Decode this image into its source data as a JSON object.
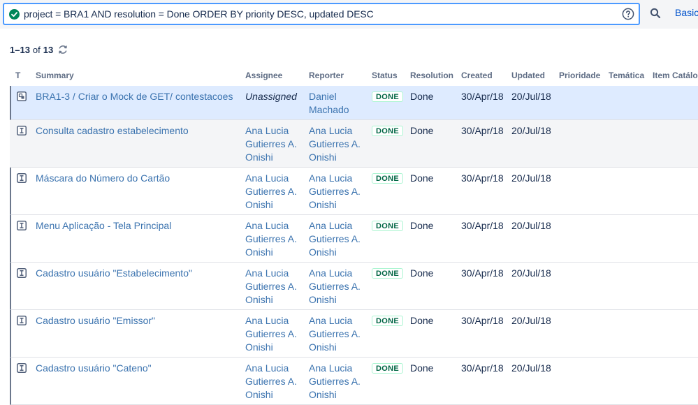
{
  "search": {
    "jql_parts": {
      "p1": "project = ",
      "p2": "BRA1",
      "p3": " ",
      "p4": "AND",
      "p5": " ",
      "p6": "resolution",
      "p7": " = ",
      "p8": "Done",
      "p9": " ORDER ",
      "p10": "BY",
      "p11": " priority DESC, ",
      "p12": "updated",
      "p13": " ",
      "p14": "DESC"
    },
    "valid_icon": "check-circle-icon",
    "help_icon": "question-circle-icon",
    "search_icon": "magnifier-icon",
    "basic_label": "Basic"
  },
  "results": {
    "range": "1–13",
    "of_label": "of",
    "total": "13",
    "refresh_icon": "refresh-icon"
  },
  "columns": {
    "type": "T",
    "summary": "Summary",
    "assignee": "Assignee",
    "reporter": "Reporter",
    "status": "Status",
    "resolution": "Resolution",
    "created": "Created",
    "updated": "Updated",
    "priority": "Prioridade",
    "tematica": "Temática",
    "item": "Item Catálog"
  },
  "rows": [
    {
      "type_icon": "subtask-icon",
      "summary_parent": "BRA1-3",
      "summary_sep": " / ",
      "summary": "Criar o Mock de GET/ contestacoes",
      "assignee": [
        "Unassigned"
      ],
      "reporter": [
        "Daniel",
        "Machado"
      ],
      "status": "DONE",
      "resolution": "Done",
      "created": "30/Apr/18",
      "updated": "20/Jul/18"
    },
    {
      "type_icon": "story-icon",
      "summary": "Consulta cadastro estabelecimento",
      "assignee": [
        "Ana Lucia",
        "Gutierres A.",
        "Onishi"
      ],
      "reporter": [
        "Ana Lucia",
        "Gutierres A.",
        "Onishi"
      ],
      "status": "DONE",
      "resolution": "Done",
      "created": "30/Apr/18",
      "updated": "20/Jul/18"
    },
    {
      "type_icon": "story-icon",
      "summary": "Máscara do Número do Cartão",
      "assignee": [
        "Ana Lucia",
        "Gutierres A.",
        "Onishi"
      ],
      "reporter": [
        "Ana Lucia",
        "Gutierres A.",
        "Onishi"
      ],
      "status": "DONE",
      "resolution": "Done",
      "created": "30/Apr/18",
      "updated": "20/Jul/18"
    },
    {
      "type_icon": "story-icon",
      "summary": "Menu Aplicação - Tela Principal",
      "assignee": [
        "Ana Lucia",
        "Gutierres A.",
        "Onishi"
      ],
      "reporter": [
        "Ana Lucia",
        "Gutierres A.",
        "Onishi"
      ],
      "status": "DONE",
      "resolution": "Done",
      "created": "30/Apr/18",
      "updated": "20/Jul/18"
    },
    {
      "type_icon": "story-icon",
      "summary": "Cadastro usuário \"Estabelecimento\"",
      "assignee": [
        "Ana Lucia",
        "Gutierres A.",
        "Onishi"
      ],
      "reporter": [
        "Ana Lucia",
        "Gutierres A.",
        "Onishi"
      ],
      "status": "DONE",
      "resolution": "Done",
      "created": "30/Apr/18",
      "updated": "20/Jul/18"
    },
    {
      "type_icon": "story-icon",
      "summary": "Cadastro usuário \"Emissor\"",
      "assignee": [
        "Ana Lucia",
        "Gutierres A.",
        "Onishi"
      ],
      "reporter": [
        "Ana Lucia",
        "Gutierres A.",
        "Onishi"
      ],
      "status": "DONE",
      "resolution": "Done",
      "created": "30/Apr/18",
      "updated": "20/Jul/18"
    },
    {
      "type_icon": "story-icon",
      "summary": "Cadastro usuário \"Cateno\"",
      "assignee": [
        "Ana Lucia",
        "Gutierres A.",
        "Onishi"
      ],
      "reporter": [
        "Ana Lucia",
        "Gutierres A.",
        "Onishi"
      ],
      "status": "DONE",
      "resolution": "Done",
      "created": "30/Apr/18",
      "updated": "20/Jul/18"
    }
  ],
  "colors": {
    "link": "#3b73af",
    "focus_border": "#4c9aff",
    "done_text": "#006644",
    "done_border": "#abf5d1",
    "selected_row": "#deebff",
    "valid_green": "#00875a"
  }
}
